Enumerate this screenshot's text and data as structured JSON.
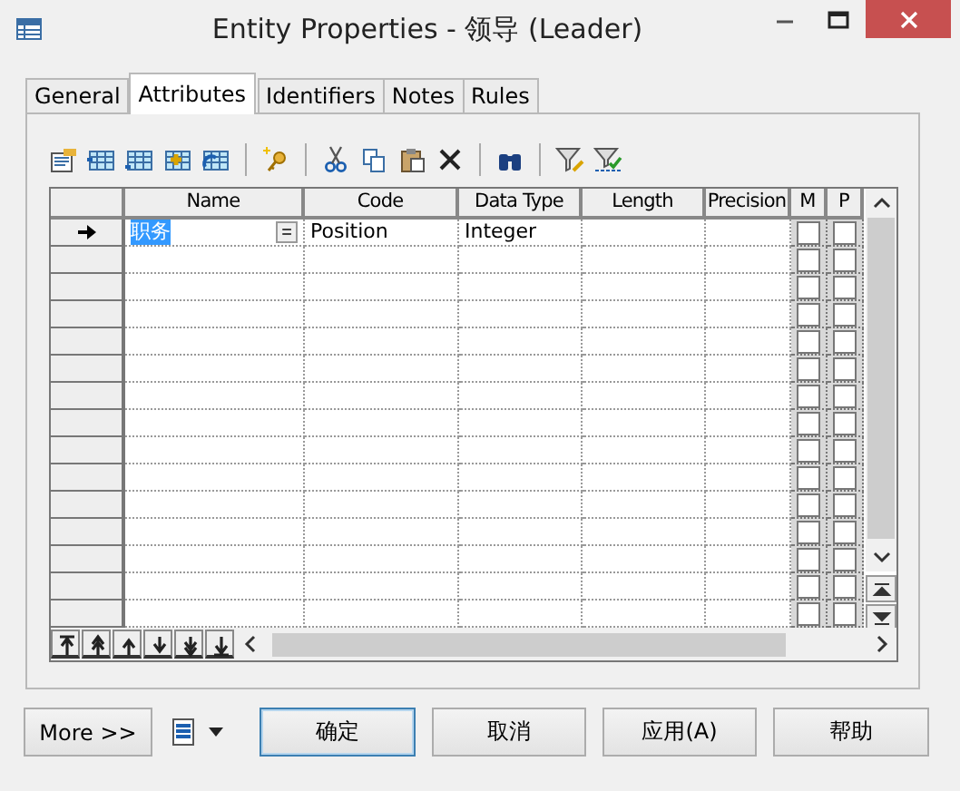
{
  "window": {
    "title": "Entity Properties - 领导 (Leader)"
  },
  "tabs": [
    {
      "label": "General",
      "selected": false
    },
    {
      "label": "Attributes",
      "selected": true
    },
    {
      "label": "Identifiers",
      "selected": false
    },
    {
      "label": "Notes",
      "selected": false
    },
    {
      "label": "Rules",
      "selected": false
    }
  ],
  "table": {
    "columns": [
      "Name",
      "Code",
      "Data Type",
      "Length",
      "Precision",
      "M",
      "P"
    ],
    "rows": [
      {
        "current": true,
        "name": "职务",
        "name_selected": true,
        "name_button": "=",
        "code": "Position",
        "data_type": "Integer",
        "m": false,
        "p": false
      },
      {
        "current": false,
        "m": false,
        "p": false
      },
      {
        "current": false,
        "m": false,
        "p": false
      },
      {
        "current": false,
        "m": false,
        "p": false
      },
      {
        "current": false,
        "m": false,
        "p": false
      },
      {
        "current": false,
        "m": false,
        "p": false
      },
      {
        "current": false,
        "m": false,
        "p": false
      },
      {
        "current": false,
        "m": false,
        "p": false
      },
      {
        "current": false,
        "m": false,
        "p": false
      },
      {
        "current": false,
        "m": false,
        "p": false
      },
      {
        "current": false,
        "m": false,
        "p": false
      },
      {
        "current": false,
        "m": false,
        "p": false
      },
      {
        "current": false,
        "m": false,
        "p": false
      },
      {
        "current": false,
        "m": false,
        "p": false
      },
      {
        "current": false,
        "m": false,
        "p": false
      }
    ]
  },
  "buttons": [
    {
      "label": "More >>",
      "default": false
    },
    {
      "label": "确定",
      "default": true
    },
    {
      "label": "取消",
      "default": false
    },
    {
      "label": "应用(A)",
      "default": false
    },
    {
      "label": "帮助",
      "default": false
    }
  ]
}
